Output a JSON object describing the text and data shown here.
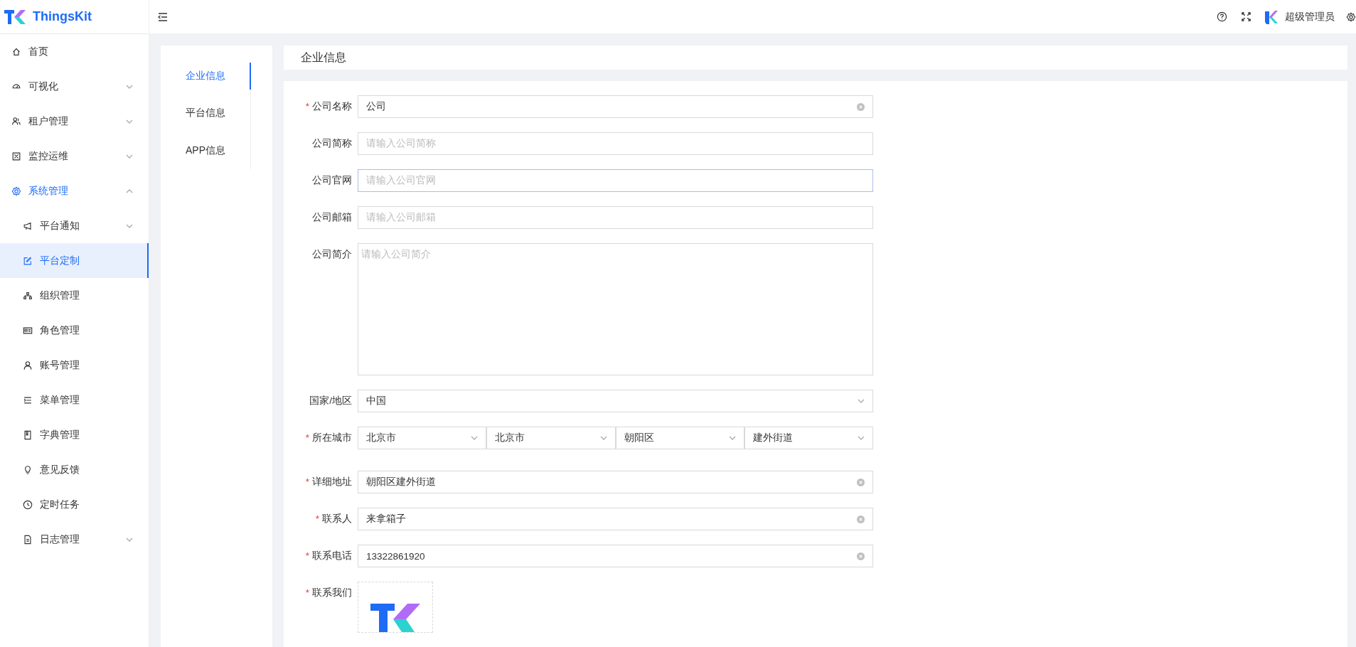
{
  "logo": {
    "text": "ThingsKit"
  },
  "sidebar": {
    "items": [
      {
        "label": "首页",
        "expandable": false,
        "expanded": false,
        "selected": false
      },
      {
        "label": "可视化",
        "expandable": true,
        "expanded": false,
        "selected": false
      },
      {
        "label": "租户管理",
        "expandable": true,
        "expanded": false,
        "selected": false
      },
      {
        "label": "监控运维",
        "expandable": true,
        "expanded": false,
        "selected": false
      },
      {
        "label": "系统管理",
        "expandable": true,
        "expanded": true,
        "selected": false,
        "children": [
          {
            "label": "平台通知",
            "expandable": true,
            "expanded": false,
            "selected": false
          },
          {
            "label": "平台定制",
            "expandable": false,
            "expanded": false,
            "selected": true
          },
          {
            "label": "组织管理",
            "expandable": false,
            "expanded": false,
            "selected": false
          },
          {
            "label": "角色管理",
            "expandable": false,
            "expanded": false,
            "selected": false
          },
          {
            "label": "账号管理",
            "expandable": false,
            "expanded": false,
            "selected": false
          },
          {
            "label": "菜单管理",
            "expandable": false,
            "expanded": false,
            "selected": false
          },
          {
            "label": "字典管理",
            "expandable": false,
            "expanded": false,
            "selected": false
          },
          {
            "label": "意见反馈",
            "expandable": false,
            "expanded": false,
            "selected": false
          },
          {
            "label": "定时任务",
            "expandable": false,
            "expanded": false,
            "selected": false
          },
          {
            "label": "日志管理",
            "expandable": true,
            "expanded": false,
            "selected": false
          }
        ]
      }
    ]
  },
  "header": {
    "user": "超级管理员"
  },
  "tabs": [
    {
      "label": "企业信息",
      "selected": true
    },
    {
      "label": "平台信息",
      "selected": false
    },
    {
      "label": "APP信息",
      "selected": false
    }
  ],
  "section_title": "企业信息",
  "form": {
    "fields": [
      {
        "kind": "text",
        "label": "公司名称",
        "required_mark": "*",
        "value": "公司",
        "focused": false
      },
      {
        "kind": "text",
        "label": "公司简称",
        "placeholder": "请输入公司简称",
        "focused": false
      },
      {
        "kind": "text",
        "label": "公司官网",
        "placeholder": "请输入公司官网",
        "focused": true
      },
      {
        "kind": "text",
        "label": "公司邮箱",
        "placeholder": "请输入公司邮箱",
        "focused": false
      },
      {
        "kind": "textarea",
        "label": "公司简介",
        "placeholder": "请输入公司简介",
        "focused": false
      },
      {
        "kind": "select",
        "label": "国家/地区",
        "values": [
          "中国"
        ]
      },
      {
        "kind": "select",
        "label": "所在城市",
        "required_mark": "*",
        "values": [
          "北京市",
          "北京市",
          "朝阳区",
          "建外街道"
        ]
      },
      {
        "kind": "text",
        "label": "详细地址",
        "required_mark": "*",
        "value": "朝阳区建外街道",
        "focused": false
      },
      {
        "kind": "text",
        "label": "联系人",
        "required_mark": "*",
        "value": "来拿箱子",
        "focused": false
      },
      {
        "kind": "text",
        "label": "联系电话",
        "required_mark": "*",
        "value": "13322861920",
        "focused": false
      },
      {
        "kind": "upload",
        "label": "联系我们",
        "required_mark": "*"
      }
    ]
  }
}
